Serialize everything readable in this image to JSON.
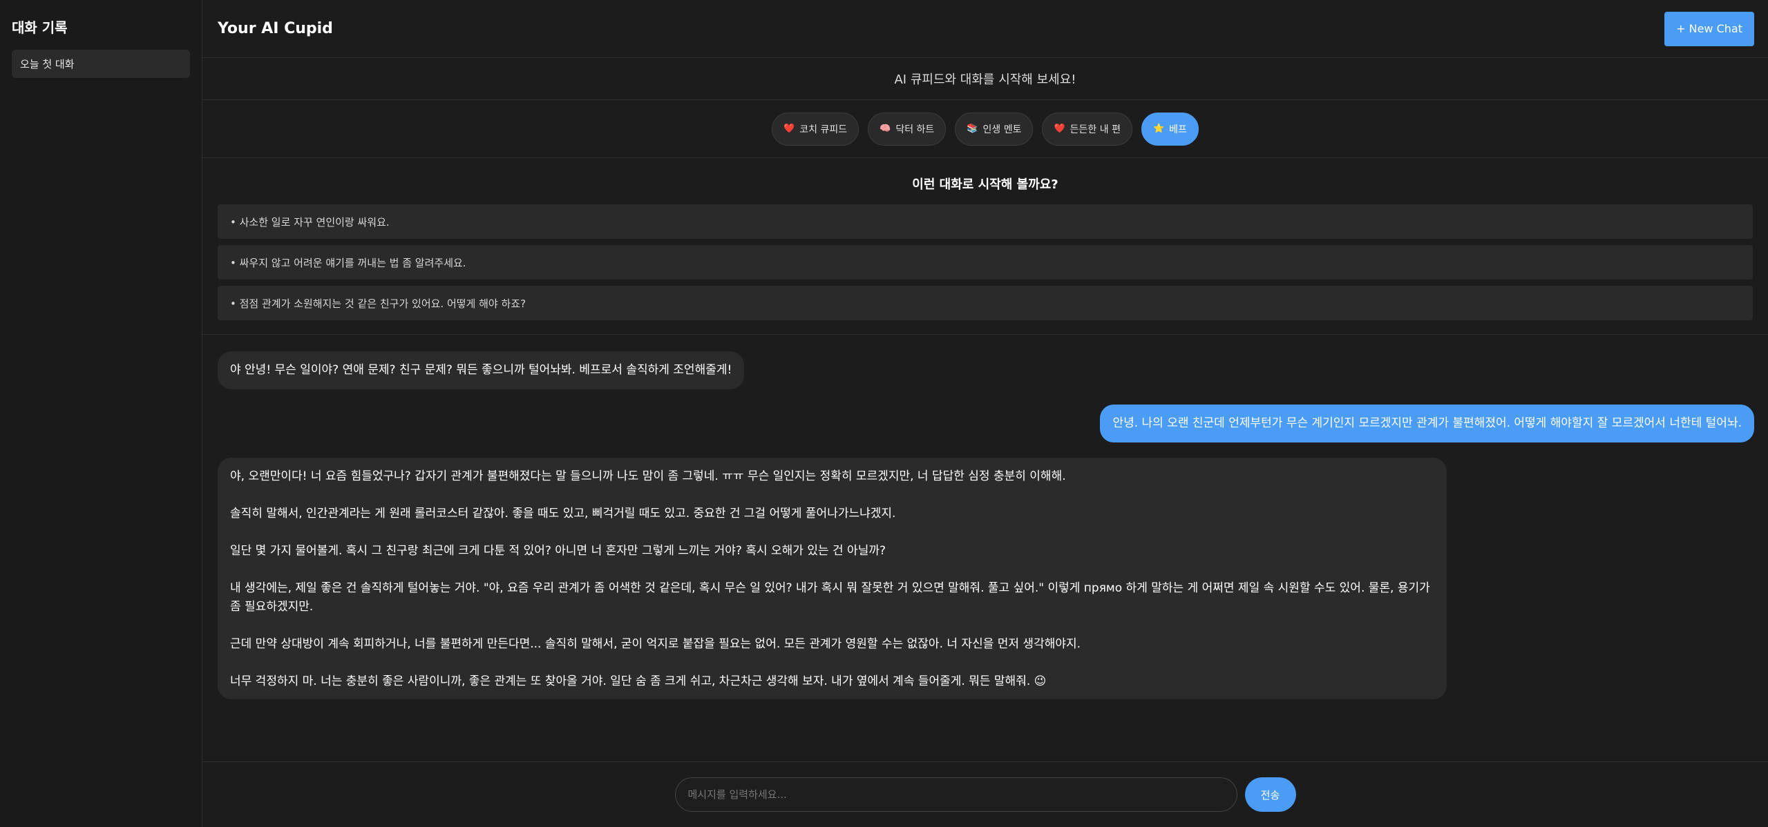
{
  "sidebar": {
    "title": "대화 기록",
    "items": [
      {
        "label": "오늘 첫 대화"
      }
    ]
  },
  "header": {
    "title": "Your AI Cupid",
    "new_chat_label": "+ New Chat"
  },
  "subtitle": "AI 큐피드와 대화를 시작해 보세요!",
  "personas": [
    {
      "label": "코치 큐피드",
      "icon": "❤️",
      "icon_name": "heart-icon",
      "active": false
    },
    {
      "label": "닥터 하트",
      "icon": "🧠",
      "icon_name": "brain-icon",
      "active": false
    },
    {
      "label": "인생 멘토",
      "icon": "📚",
      "icon_name": "books-icon",
      "active": false
    },
    {
      "label": "든든한 내 편",
      "icon": "❤️",
      "icon_name": "heart-icon",
      "active": false
    },
    {
      "label": "베프",
      "icon": "⭐",
      "icon_name": "star-icon",
      "active": true
    }
  ],
  "suggestions": {
    "title": "이런 대화로 시작해 볼까요?",
    "items": [
      "• 사소한 일로 자꾸 연인이랑 싸워요.",
      "• 싸우지 않고 어려운 얘기를 꺼내는 법 좀 알려주세요.",
      "• 점점 관계가 소원해지는 것 같은 친구가 있어요. 어떻게 해야 하죠?"
    ]
  },
  "messages": {
    "greeting": "야 안녕! 무슨 일이야? 연애 문제? 친구 문제? 뭐든 좋으니까 털어놔봐. 베프로서 솔직하게 조언해줄게!",
    "user": "안녕. 나의 오랜 친군데 언제부턴가 무슨 계기인지 모르겠지만 관계가 불편해졌어. 어떻게 해야할지 잘 모르겠어서 너한테 털어놔.",
    "reply": [
      "야, 오랜만이다! 너 요즘 힘들었구나? 갑자기 관계가 불편해졌다는 말 들으니까 나도 맘이 좀 그렇네. ㅠㅠ 무슨 일인지는 정확히 모르겠지만, 너 답답한 심정 충분히 이해해.",
      "솔직히 말해서, 인간관계라는 게 원래 롤러코스터 같잖아. 좋을 때도 있고, 삐걱거릴 때도 있고. 중요한 건 그걸 어떻게 풀어나가느냐겠지.",
      "일단 몇 가지 물어볼게. 혹시 그 친구랑 최근에 크게 다툰 적 있어? 아니면 너 혼자만 그렇게 느끼는 거야? 혹시 오해가 있는 건 아닐까?",
      "내 생각에는, 제일 좋은 건 솔직하게 털어놓는 거야. \"야, 요즘 우리 관계가 좀 어색한 것 같은데, 혹시 무슨 일 있어? 내가 혹시 뭐 잘못한 거 있으면 말해줘. 풀고 싶어.\" 이렇게 прямо 하게 말하는 게 어쩌면 제일 속 시원할 수도 있어. 물론, 용기가 좀 필요하겠지만.",
      "근데 만약 상대방이 계속 회피하거나, 너를 불편하게 만든다면... 솔직히 말해서, 굳이 억지로 붙잡을 필요는 없어. 모든 관계가 영원할 수는 없잖아. 너 자신을 먼저 생각해야지.",
      "너무 걱정하지 마. 너는 충분히 좋은 사람이니까, 좋은 관계는 또 찾아올 거야. 일단 숨 좀 크게 쉬고, 차근차근 생각해 보자. 내가 옆에서 계속 들어줄게. 뭐든 말해줘. 😉"
    ]
  },
  "input": {
    "placeholder": "메시지를 입력하세요...",
    "send_label": "전송"
  },
  "colors": {
    "accent": "#4a9cf5",
    "background": "#1c1c1c",
    "bubble_bot": "#2b2b2b"
  }
}
